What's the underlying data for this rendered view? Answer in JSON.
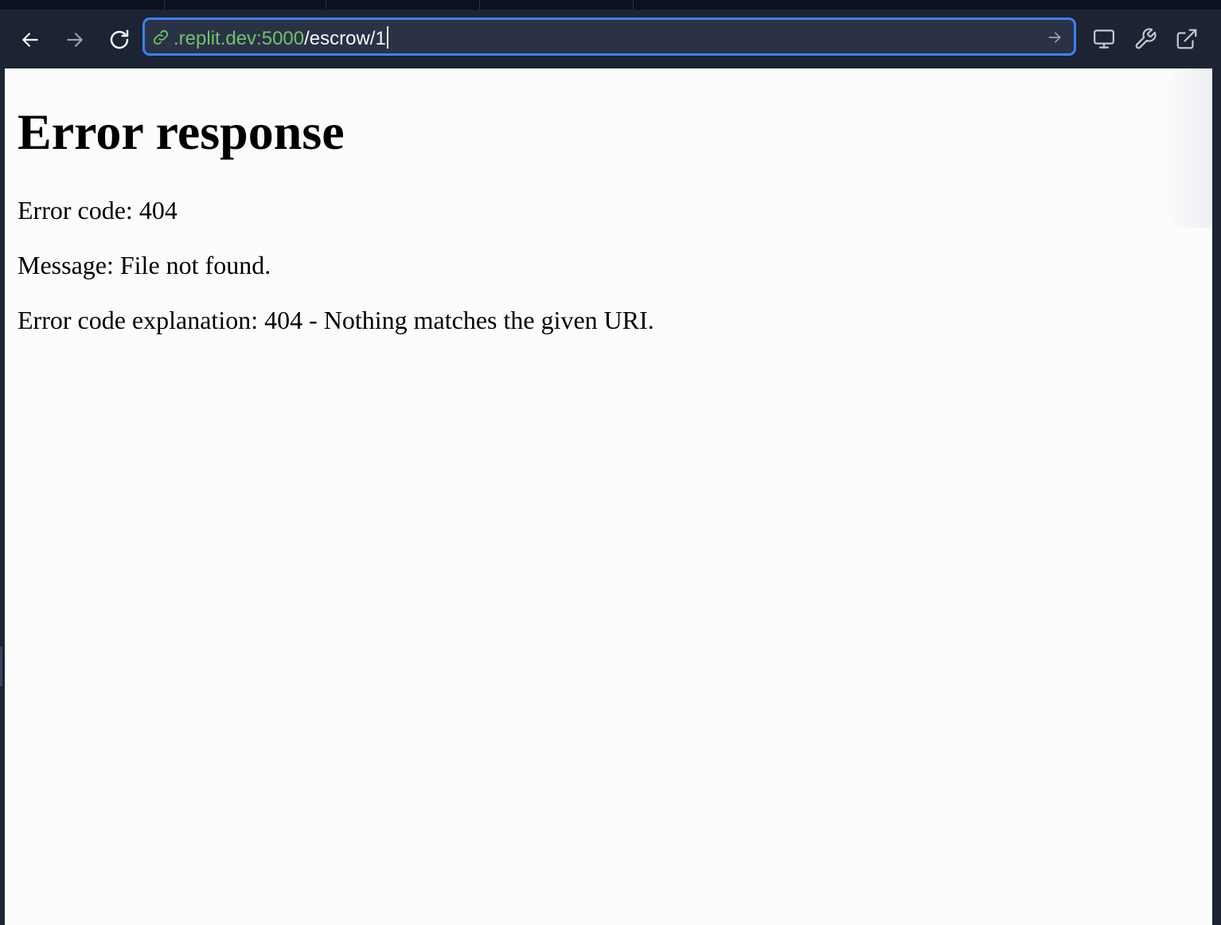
{
  "browser": {
    "url_host": ".replit.dev:5000",
    "url_path": "/escrow/1"
  },
  "page": {
    "heading": "Error response",
    "error_code": "Error code: 404",
    "message": "Message: File not found.",
    "explanation": "Error code explanation: 404 - Nothing matches the given URI."
  },
  "colors": {
    "chrome_background": "#1c2333",
    "url_focus_border": "#3b82f6",
    "url_host": "#6cc46a",
    "page_background": "#fcfcfc"
  },
  "icons": {
    "back": "arrow-left-icon",
    "forward": "arrow-right-icon",
    "reload": "reload-icon",
    "link": "link-icon",
    "go": "go-arrow-icon",
    "devices": "monitor-icon",
    "devtools": "wrench-icon",
    "open_new_tab": "external-link-icon"
  }
}
